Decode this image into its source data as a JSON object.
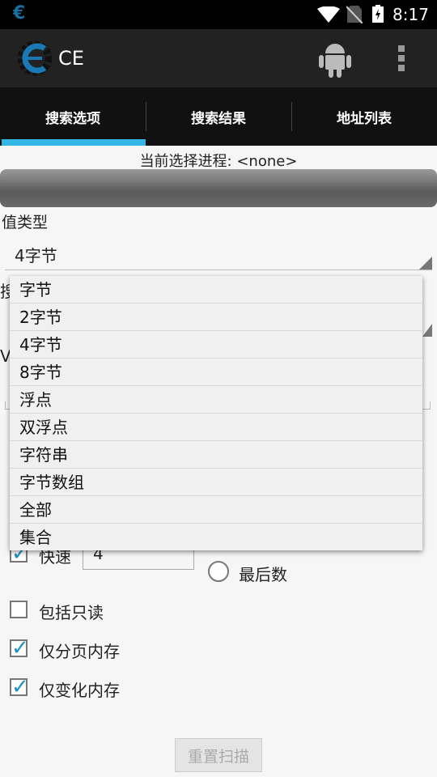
{
  "status_bar": {
    "time": "8:17",
    "icons": [
      "ce-notification-icon",
      "wifi-icon",
      "no-sim-icon",
      "battery-charging-icon"
    ]
  },
  "action_bar": {
    "title": "CE",
    "icons": [
      "ce-logo-icon",
      "android-icon",
      "overflow-menu-icon"
    ]
  },
  "tabs": [
    {
      "label": "搜索选项",
      "selected": true
    },
    {
      "label": "搜索结果"
    },
    {
      "label": "地址列表"
    }
  ],
  "colors": {
    "accent": "#33b5e5",
    "checkbox": "#1e8fc8"
  },
  "process_label": "当前选择进程: <none>",
  "value_type": {
    "label": "值类型",
    "selected": "4字节"
  },
  "obscured": {
    "scan_type_fragment": "搜",
    "value_fragment": "V"
  },
  "dropdown": {
    "options": [
      "字节",
      "2字节",
      "4字节",
      "8字节",
      "浮点",
      "双浮点",
      "字符串",
      "字节数组",
      "全部",
      "集合"
    ]
  },
  "fast_scan": {
    "label": "快速",
    "checked": true,
    "value": "4"
  },
  "last_digits": {
    "label": "最后数",
    "selected": false
  },
  "options": [
    {
      "label": "包括只读",
      "checked": false
    },
    {
      "label": "仅分页内存",
      "checked": true
    },
    {
      "label": "仅变化内存",
      "checked": true
    }
  ],
  "reset_button": {
    "label": "重置扫描",
    "enabled": false
  }
}
